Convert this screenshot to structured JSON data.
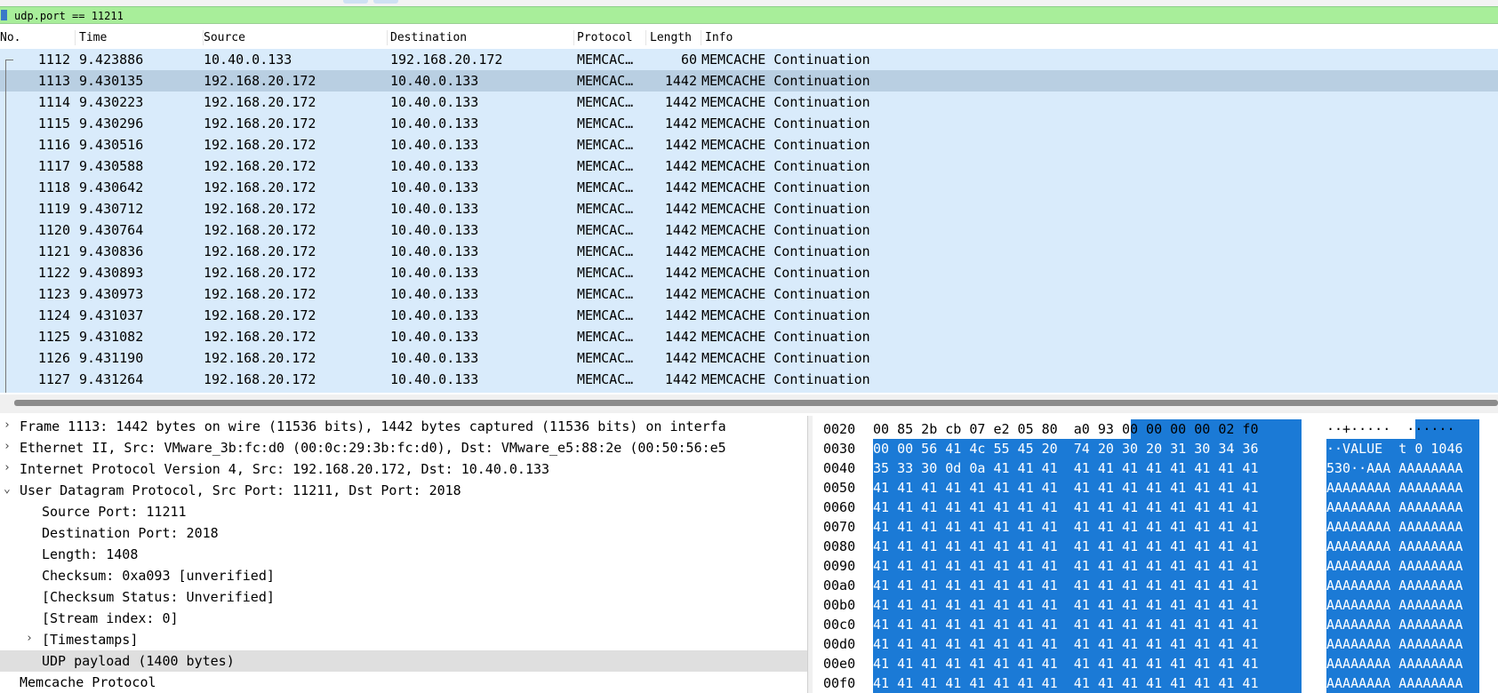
{
  "filter": {
    "value": "udp.port == 11211"
  },
  "packet_list": {
    "columns": [
      "No.",
      "Time",
      "Source",
      "Destination",
      "Protocol",
      "Length",
      "Info"
    ],
    "rows": [
      {
        "no": "1112",
        "time": "9.423886",
        "src": "10.40.0.133",
        "dst": "192.168.20.172",
        "proto": "MEMCAC…",
        "len": "60",
        "info": "MEMCACHE Continuation"
      },
      {
        "no": "1113",
        "time": "9.430135",
        "src": "192.168.20.172",
        "dst": "10.40.0.133",
        "proto": "MEMCAC…",
        "len": "1442",
        "info": "MEMCACHE Continuation",
        "selected": true
      },
      {
        "no": "1114",
        "time": "9.430223",
        "src": "192.168.20.172",
        "dst": "10.40.0.133",
        "proto": "MEMCAC…",
        "len": "1442",
        "info": "MEMCACHE Continuation"
      },
      {
        "no": "1115",
        "time": "9.430296",
        "src": "192.168.20.172",
        "dst": "10.40.0.133",
        "proto": "MEMCAC…",
        "len": "1442",
        "info": "MEMCACHE Continuation"
      },
      {
        "no": "1116",
        "time": "9.430516",
        "src": "192.168.20.172",
        "dst": "10.40.0.133",
        "proto": "MEMCAC…",
        "len": "1442",
        "info": "MEMCACHE Continuation"
      },
      {
        "no": "1117",
        "time": "9.430588",
        "src": "192.168.20.172",
        "dst": "10.40.0.133",
        "proto": "MEMCAC…",
        "len": "1442",
        "info": "MEMCACHE Continuation"
      },
      {
        "no": "1118",
        "time": "9.430642",
        "src": "192.168.20.172",
        "dst": "10.40.0.133",
        "proto": "MEMCAC…",
        "len": "1442",
        "info": "MEMCACHE Continuation"
      },
      {
        "no": "1119",
        "time": "9.430712",
        "src": "192.168.20.172",
        "dst": "10.40.0.133",
        "proto": "MEMCAC…",
        "len": "1442",
        "info": "MEMCACHE Continuation"
      },
      {
        "no": "1120",
        "time": "9.430764",
        "src": "192.168.20.172",
        "dst": "10.40.0.133",
        "proto": "MEMCAC…",
        "len": "1442",
        "info": "MEMCACHE Continuation"
      },
      {
        "no": "1121",
        "time": "9.430836",
        "src": "192.168.20.172",
        "dst": "10.40.0.133",
        "proto": "MEMCAC…",
        "len": "1442",
        "info": "MEMCACHE Continuation"
      },
      {
        "no": "1122",
        "time": "9.430893",
        "src": "192.168.20.172",
        "dst": "10.40.0.133",
        "proto": "MEMCAC…",
        "len": "1442",
        "info": "MEMCACHE Continuation"
      },
      {
        "no": "1123",
        "time": "9.430973",
        "src": "192.168.20.172",
        "dst": "10.40.0.133",
        "proto": "MEMCAC…",
        "len": "1442",
        "info": "MEMCACHE Continuation"
      },
      {
        "no": "1124",
        "time": "9.431037",
        "src": "192.168.20.172",
        "dst": "10.40.0.133",
        "proto": "MEMCAC…",
        "len": "1442",
        "info": "MEMCACHE Continuation"
      },
      {
        "no": "1125",
        "time": "9.431082",
        "src": "192.168.20.172",
        "dst": "10.40.0.133",
        "proto": "MEMCAC…",
        "len": "1442",
        "info": "MEMCACHE Continuation"
      },
      {
        "no": "1126",
        "time": "9.431190",
        "src": "192.168.20.172",
        "dst": "10.40.0.133",
        "proto": "MEMCAC…",
        "len": "1442",
        "info": "MEMCACHE Continuation"
      },
      {
        "no": "1127",
        "time": "9.431264",
        "src": "192.168.20.172",
        "dst": "10.40.0.133",
        "proto": "MEMCAC…",
        "len": "1442",
        "info": "MEMCACHE Continuation"
      }
    ]
  },
  "details": {
    "rows": [
      {
        "arrow": "›",
        "text": "Frame 1113: 1442 bytes on wire (11536 bits), 1442 bytes captured (11536 bits) on interfa"
      },
      {
        "arrow": "›",
        "text": "Ethernet II, Src: VMware_3b:fc:d0 (00:0c:29:3b:fc:d0), Dst: VMware_e5:88:2e (00:50:56:e5"
      },
      {
        "arrow": "›",
        "text": "Internet Protocol Version 4, Src: 192.168.20.172, Dst: 10.40.0.133"
      },
      {
        "arrow": "⌄",
        "text": "User Datagram Protocol, Src Port: 11211, Dst Port: 2018"
      },
      {
        "arrow": "",
        "text": "Source Port: 11211",
        "indent": 1
      },
      {
        "arrow": "",
        "text": "Destination Port: 2018",
        "indent": 1
      },
      {
        "arrow": "",
        "text": "Length: 1408",
        "indent": 1
      },
      {
        "arrow": "",
        "text": "Checksum: 0xa093 [unverified]",
        "indent": 1
      },
      {
        "arrow": "",
        "text": "[Checksum Status: Unverified]",
        "indent": 1
      },
      {
        "arrow": "",
        "text": "[Stream index: 0]",
        "indent": 1
      },
      {
        "arrow": "›",
        "text": "[Timestamps]",
        "indent": 1
      },
      {
        "arrow": "",
        "text": "UDP payload (1400 bytes)",
        "indent": 1,
        "highlight": true
      },
      {
        "arrow": "",
        "text": "Memcache Protocol"
      }
    ]
  },
  "hex": {
    "rows": [
      {
        "off": "0020",
        "bytes": "00 85 2b cb 07 e2 05 80  a0 93 00 00 00 00 02 f0",
        "ascii": "··+·····  ······"
      },
      {
        "off": "0030",
        "bytes": "00 00 56 41 4c 55 45 20  74 20 30 20 31 30 34 36",
        "ascii": "··VALUE  t 0 1046"
      },
      {
        "off": "0040",
        "bytes": "35 33 30 0d 0a 41 41 41  41 41 41 41 41 41 41 41",
        "ascii": "530··AAA AAAAAAAA"
      },
      {
        "off": "0050",
        "bytes": "41 41 41 41 41 41 41 41  41 41 41 41 41 41 41 41",
        "ascii": "AAAAAAAA AAAAAAAA"
      },
      {
        "off": "0060",
        "bytes": "41 41 41 41 41 41 41 41  41 41 41 41 41 41 41 41",
        "ascii": "AAAAAAAA AAAAAAAA"
      },
      {
        "off": "0070",
        "bytes": "41 41 41 41 41 41 41 41  41 41 41 41 41 41 41 41",
        "ascii": "AAAAAAAA AAAAAAAA"
      },
      {
        "off": "0080",
        "bytes": "41 41 41 41 41 41 41 41  41 41 41 41 41 41 41 41",
        "ascii": "AAAAAAAA AAAAAAAA"
      },
      {
        "off": "0090",
        "bytes": "41 41 41 41 41 41 41 41  41 41 41 41 41 41 41 41",
        "ascii": "AAAAAAAA AAAAAAAA"
      },
      {
        "off": "00a0",
        "bytes": "41 41 41 41 41 41 41 41  41 41 41 41 41 41 41 41",
        "ascii": "AAAAAAAA AAAAAAAA"
      },
      {
        "off": "00b0",
        "bytes": "41 41 41 41 41 41 41 41  41 41 41 41 41 41 41 41",
        "ascii": "AAAAAAAA AAAAAAAA"
      },
      {
        "off": "00c0",
        "bytes": "41 41 41 41 41 41 41 41  41 41 41 41 41 41 41 41",
        "ascii": "AAAAAAAA AAAAAAAA"
      },
      {
        "off": "00d0",
        "bytes": "41 41 41 41 41 41 41 41  41 41 41 41 41 41 41 41",
        "ascii": "AAAAAAAA AAAAAAAA"
      },
      {
        "off": "00e0",
        "bytes": "41 41 41 41 41 41 41 41  41 41 41 41 41 41 41 41",
        "ascii": "AAAAAAAA AAAAAAAA"
      },
      {
        "off": "00f0",
        "bytes": "41 41 41 41 41 41 41 41  41 41 41 41 41 41 41 41",
        "ascii": "AAAAAAAA AAAAAAAA"
      }
    ]
  },
  "colors": {
    "filter_valid": "#a8ee9a",
    "row_bg": "#d9ebfb",
    "row_selected": "#b9cfe2",
    "hex_selection": "#1b7ad6"
  }
}
